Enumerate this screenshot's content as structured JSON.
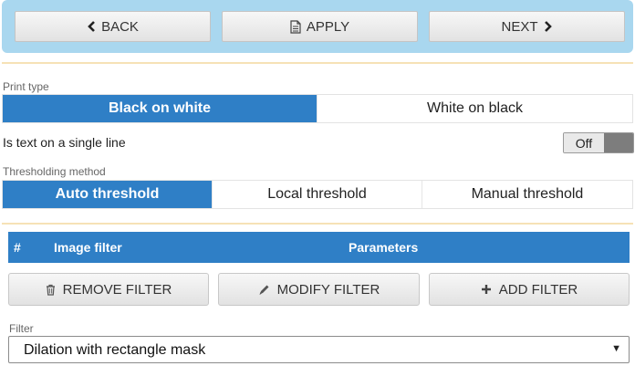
{
  "nav": {
    "back_label": "BACK",
    "apply_label": "APPLY",
    "next_label": "NEXT"
  },
  "print_type": {
    "label": "Print type",
    "options": [
      "Black on white",
      "White on black"
    ],
    "selected": "Black on white"
  },
  "single_line": {
    "label": "Is text on a single line",
    "toggle_label": "Off"
  },
  "thresholding": {
    "label": "Thresholding method",
    "options": [
      "Auto threshold",
      "Local threshold",
      "Manual threshold"
    ],
    "selected": "Auto threshold"
  },
  "filter_table": {
    "headers": [
      "#",
      "Image filter",
      "Parameters"
    ]
  },
  "actions": {
    "remove_label": "REMOVE FILTER",
    "modify_label": "MODIFY FILTER",
    "add_label": "ADD FILTER"
  },
  "filter_select": {
    "label": "Filter",
    "value": "Dilation with rectangle mask"
  },
  "icons": {
    "back": "chevron-left-icon",
    "apply": "document-icon",
    "next": "chevron-right-icon",
    "remove": "trash-icon",
    "modify": "pencil-icon",
    "add": "plus-icon",
    "select": "caret-down-icon"
  },
  "colors": {
    "nav_background": "#a9d7ef",
    "accent": "#2f7fc6",
    "separator": "#f6e2b6"
  }
}
